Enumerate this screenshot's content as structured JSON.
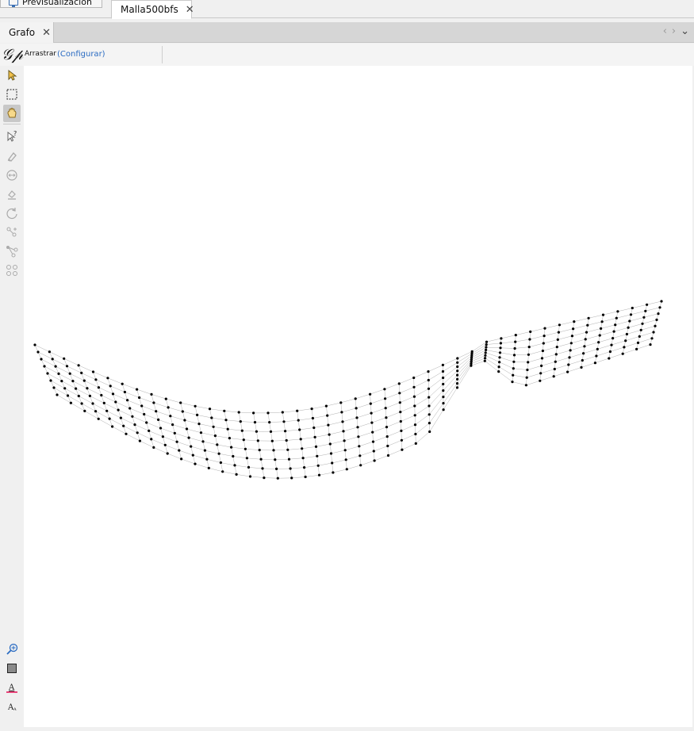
{
  "document_tabs": [
    {
      "label": "Previsualización",
      "icon": "monitor-icon",
      "active": false
    },
    {
      "label": "Malla500bfs",
      "active": true
    }
  ],
  "panel": {
    "tab_label": "Grafo",
    "close_glyph": "✕",
    "prev_glyph": "‹",
    "next_glyph": "›",
    "menu_glyph": "⌄"
  },
  "toolbar": {
    "mode_label": "Arrastrar",
    "configure_link": "(Configurar)"
  },
  "side_tools": [
    {
      "name": "select-icon",
      "selected": false
    },
    {
      "name": "rectangle-select-icon",
      "selected": false
    },
    {
      "name": "drag-hand-icon",
      "selected": true
    },
    {
      "name": "edit-query-icon",
      "selected": false
    },
    {
      "name": "brush-icon",
      "selected": false
    },
    {
      "name": "size-icon",
      "selected": false
    },
    {
      "name": "paint-bucket-icon",
      "selected": false
    },
    {
      "name": "rotate-icon",
      "selected": false
    },
    {
      "name": "add-edge-icon",
      "selected": false
    },
    {
      "name": "shortest-path-icon",
      "selected": false
    },
    {
      "name": "heat-map-icon",
      "selected": false
    }
  ],
  "bottom_tools": [
    {
      "name": "zoom-icon"
    },
    {
      "name": "background-color-icon"
    },
    {
      "name": "label-color-icon"
    },
    {
      "name": "label-size-icon"
    }
  ],
  "colors": {
    "accent_link": "#2a6bc2",
    "node": "#000000",
    "edge": "#9a9a9a",
    "label_color_underline": "#e8457a"
  }
}
